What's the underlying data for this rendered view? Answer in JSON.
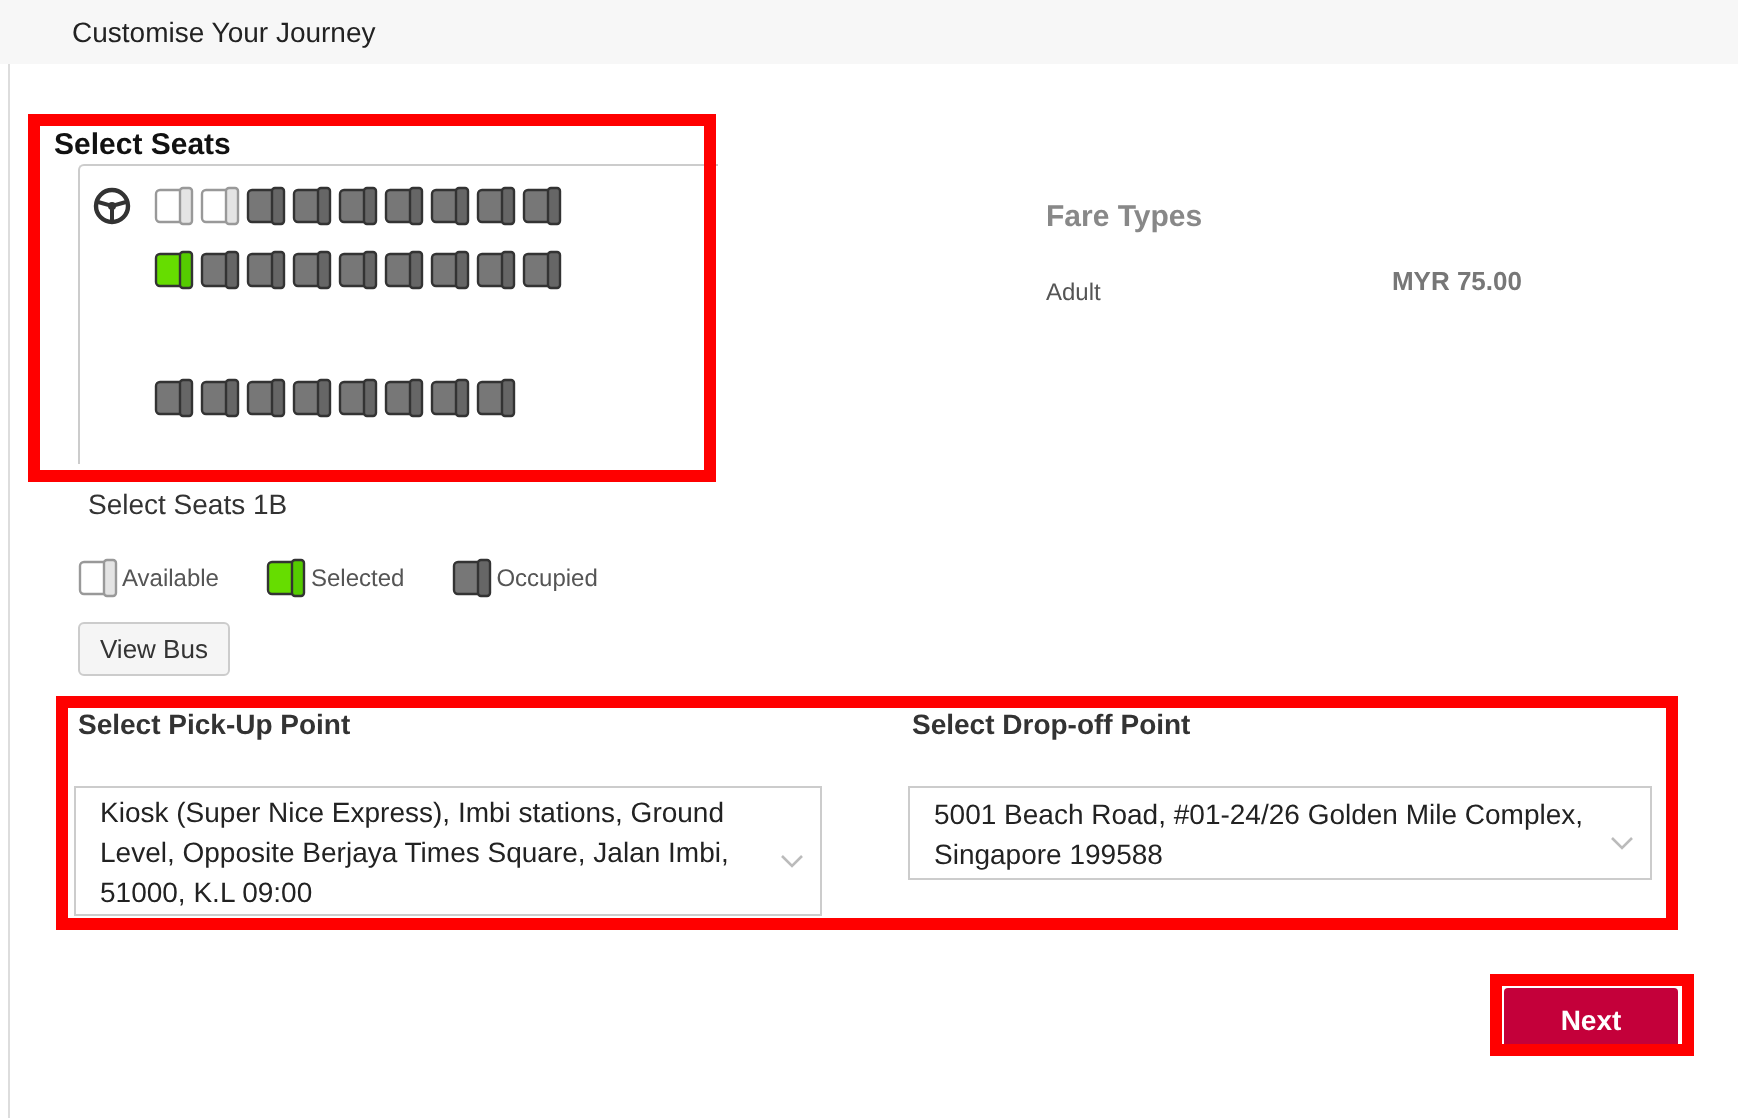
{
  "header": {
    "title": "Customise Your Journey"
  },
  "seats_section": {
    "title": "Select Seats",
    "rows": [
      {
        "has_wheel": true,
        "seats": [
          {
            "kind": "available"
          },
          {
            "kind": "available"
          },
          {
            "kind": "occupied"
          },
          {
            "kind": "occupied"
          },
          {
            "kind": "occupied"
          },
          {
            "kind": "occupied"
          },
          {
            "kind": "occupied"
          },
          {
            "kind": "occupied"
          },
          {
            "kind": "occupied"
          }
        ]
      },
      {
        "has_wheel": false,
        "seats": [
          {
            "kind": "selected"
          },
          {
            "kind": "occupied"
          },
          {
            "kind": "occupied"
          },
          {
            "kind": "occupied"
          },
          {
            "kind": "occupied"
          },
          {
            "kind": "occupied"
          },
          {
            "kind": "occupied"
          },
          {
            "kind": "occupied"
          },
          {
            "kind": "occupied"
          }
        ]
      },
      {
        "has_wheel": false,
        "seats": [
          {
            "kind": "occupied"
          },
          {
            "kind": "occupied"
          },
          {
            "kind": "occupied"
          },
          {
            "kind": "occupied"
          },
          {
            "kind": "occupied"
          },
          {
            "kind": "occupied"
          },
          {
            "kind": "occupied"
          },
          {
            "kind": "occupied"
          }
        ]
      }
    ],
    "selected_text": "Select Seats 1B"
  },
  "legend": [
    {
      "kind": "available",
      "label": "Available"
    },
    {
      "kind": "selected",
      "label": "Selected"
    },
    {
      "kind": "occupied",
      "label": "Occupied"
    }
  ],
  "view_bus_button": "View Bus",
  "fare": {
    "title": "Fare Types",
    "rows": [
      {
        "label": "Adult",
        "price": "MYR 75.00"
      }
    ]
  },
  "pickup": {
    "label": "Select Pick-Up Point",
    "value": "Kiosk (Super Nice Express), Imbi stations, Ground Level, Opposite Berjaya Times Square, Jalan Imbi, 51000, K.L 09:00"
  },
  "dropoff": {
    "label": "Select Drop-off Point",
    "value": "5001 Beach Road, #01-24/26 Golden Mile Complex, Singapore 199588"
  },
  "next_button": "Next"
}
